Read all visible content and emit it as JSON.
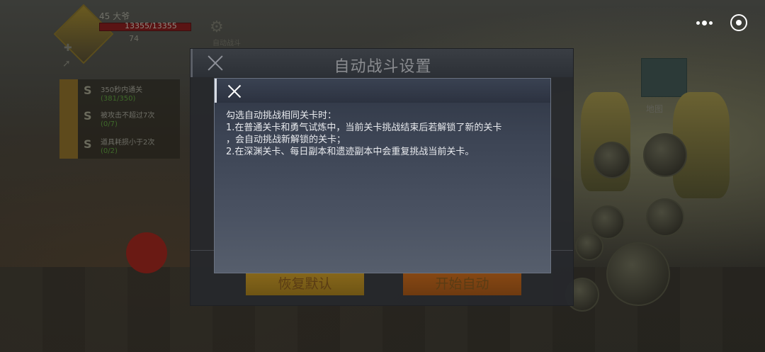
{
  "hud": {
    "level": "45 大爷",
    "hp": "13355/13355",
    "power": "74",
    "gear_label": "自动战斗"
  },
  "quests": [
    {
      "name": "350秒内通关",
      "progress": "(381/350)"
    },
    {
      "name": "被攻击不超过7次",
      "progress": "(0/7)"
    },
    {
      "name": "道具耗损小于2次",
      "progress": "(0/2)"
    }
  ],
  "minimap": {
    "label": "地图"
  },
  "top_right": {
    "more_icon": "more-dots-icon",
    "close_icon": "target-close-icon"
  },
  "settings_dialog": {
    "title": "自动战斗设置",
    "reset_button": "恢复默认",
    "start_button": "开始自动"
  },
  "info_popup": {
    "lines": [
      "勾选自动挑战相同关卡时：",
      "1.在普通关卡和勇气试炼中，当前关卡挑战结束后若解锁了新的关卡",
      "，会自动挑战新解锁的关卡；",
      "2.在深渊关卡、每日副本和遗迹副本中会重复挑战当前关卡。"
    ]
  }
}
